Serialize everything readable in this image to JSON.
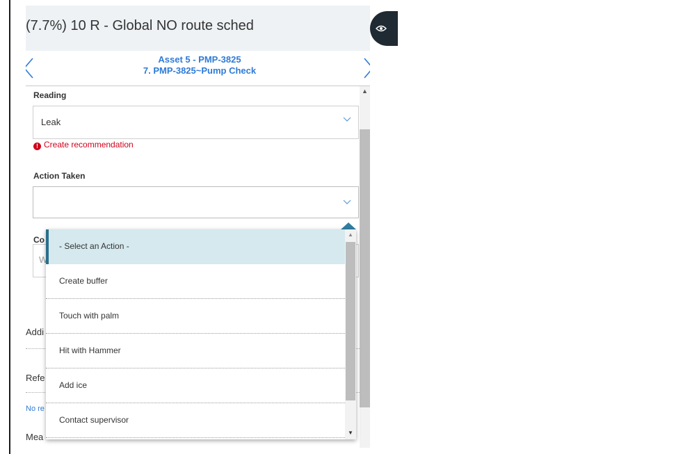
{
  "header": {
    "title": "(7.7%) 10 R - Global NO route sched",
    "toggle_icon": "eye-icon"
  },
  "nav": {
    "asset": "Asset 5 - PMP-3825",
    "step": "7. PMP-3825~Pump Check",
    "prev_icon": "chevron-left-icon",
    "next_icon": "chevron-right-icon"
  },
  "form": {
    "reading_label": "Reading",
    "reading_value": "Leak",
    "warning": "Create recommendation",
    "action_label": "Action Taken",
    "action_value": "",
    "comment_label_partial": "Co",
    "comment_placeholder_partial": "W",
    "additional_partial": "Addi",
    "reference_partial": "Refe",
    "no_reference_partial": "No re",
    "measurement_partial": "Mea"
  },
  "dropdown": {
    "options": [
      {
        "label": "- Select an Action -",
        "selected": true
      },
      {
        "label": "Create buffer",
        "selected": false
      },
      {
        "label": "Touch with palm",
        "selected": false
      },
      {
        "label": "Hit with Hammer",
        "selected": false
      },
      {
        "label": "Add ice",
        "selected": false
      },
      {
        "label": "Contact supervisor",
        "selected": false
      }
    ]
  },
  "colors": {
    "accent": "#2f7bd6",
    "warning": "#d0021b",
    "selected_bg": "#d5e9ee",
    "selected_border": "#2a6f8c"
  }
}
